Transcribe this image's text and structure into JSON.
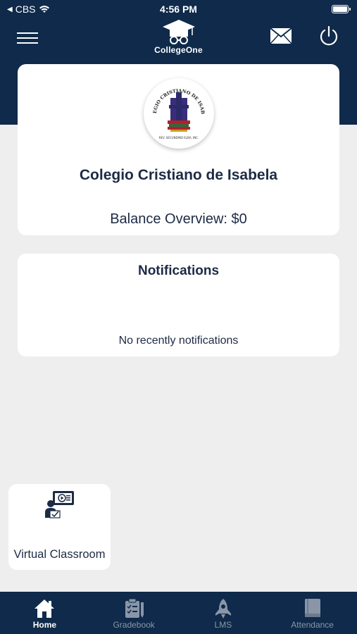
{
  "status_bar": {
    "carrier": "CBS",
    "time": "4:56 PM"
  },
  "header": {
    "app_name": "CollegeOne"
  },
  "school": {
    "name": "Colegio Cristiano de Isabela",
    "balance": "Balance Overview: $0",
    "logo_text_top": "COLEGIO CRISTIANO DE ISABELA",
    "logo_text_bottom": "REV. SECUNDINO ELBA, INC."
  },
  "notifications": {
    "title": "Notifications",
    "empty_message": "No recently notifications"
  },
  "quick_links": [
    {
      "label": "Virtual Classroom",
      "icon": "virtual-classroom-icon"
    }
  ],
  "tabs": [
    {
      "label": "Home",
      "icon": "home-icon",
      "active": true
    },
    {
      "label": "Gradebook",
      "icon": "gradebook-icon",
      "active": false
    },
    {
      "label": "LMS",
      "icon": "lms-icon",
      "active": false
    },
    {
      "label": "Attendance",
      "icon": "attendance-icon",
      "active": false
    }
  ],
  "colors": {
    "brand_navy": "#0f2a4a",
    "text_dark": "#1d2b45",
    "background": "#eeeeee",
    "tab_inactive": "#8a96a8"
  }
}
